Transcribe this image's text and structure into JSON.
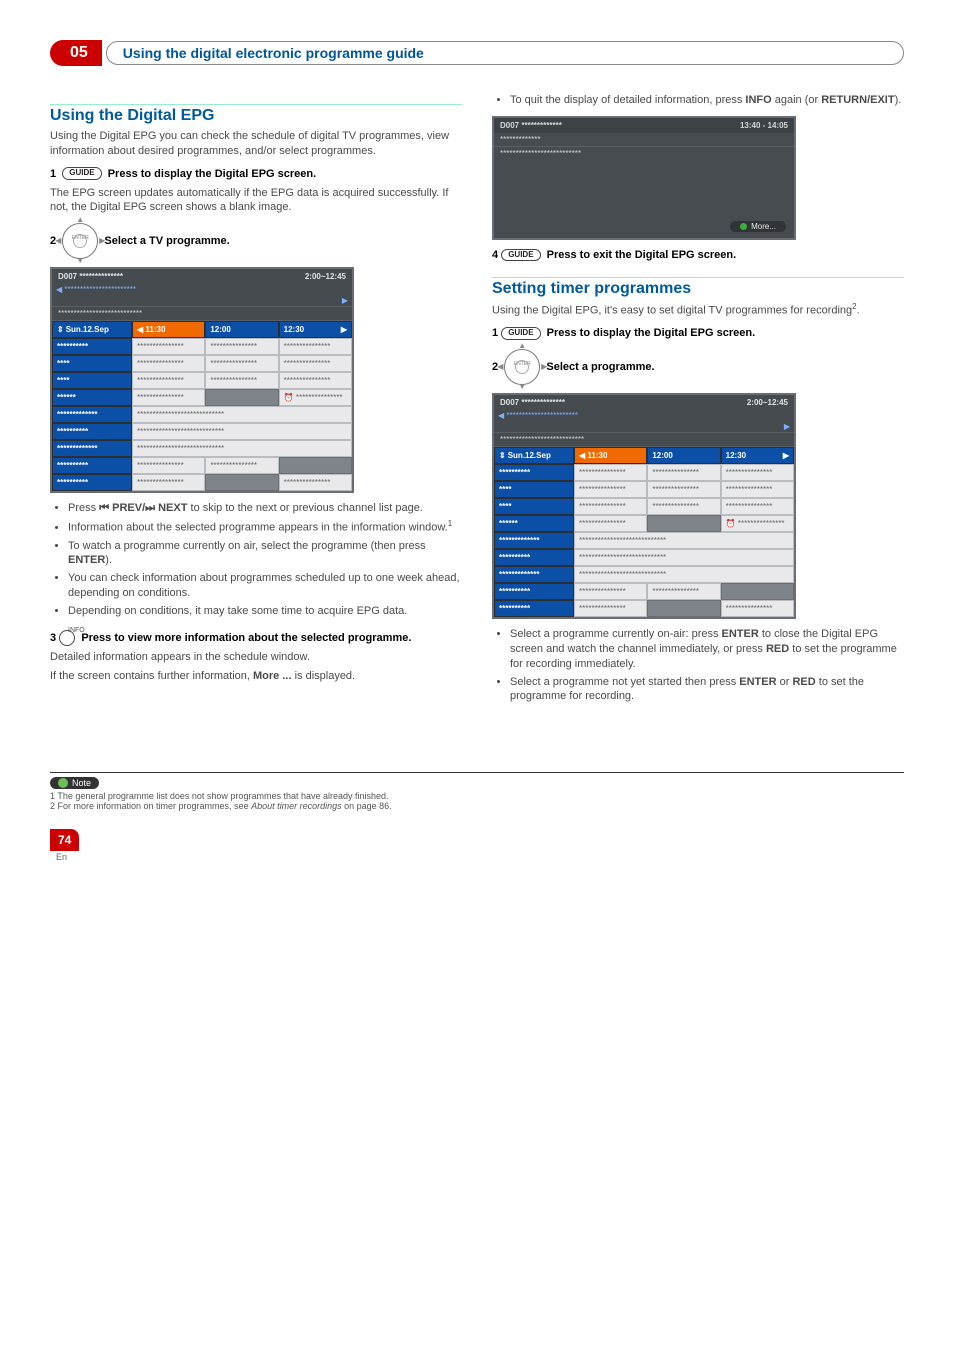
{
  "section": {
    "number": "05",
    "title": "Using the digital electronic programme guide"
  },
  "left": {
    "h_epg": "Using the Digital EPG",
    "intro": "Using the Digital EPG you can check the schedule of digital TV programmes, view information about desired programmes, and/or select programmes.",
    "step1_btn": "GUIDE",
    "step1_txt": "Press to display the Digital EPG screen.",
    "step1_desc": "The EPG screen updates automatically if the EPG data is acquired successfully. If not, the Digital EPG screen shows a blank image.",
    "step2_txt": "Select a TV programme.",
    "bullets1": [
      "Press ⏮ PREV/⏭ NEXT to skip to the next or previous channel list page.",
      "Information about the selected programme appears in the information window.",
      "To watch a programme currently on air, select the programme (then press ENTER).",
      "You can check information about programmes scheduled up to one week ahead, depending on conditions.",
      "Depending on conditions, it may take some time to acquire EPG data."
    ],
    "sup1": "1",
    "step3_label": "INFO",
    "step3_txt": "Press to view more information about the selected programme.",
    "step3_desc1": "Detailed information appears in the schedule window.",
    "step3_desc2": "If the screen contains further information, More ... is displayed."
  },
  "right": {
    "top_bullet": "To quit the display of detailed information, press INFO again (or RETURN/EXIT).",
    "info_top_left": "D007   *************",
    "info_top_right": "13:40 - 14:05",
    "info_line1": "*************",
    "info_line2": "**************************",
    "info_more": "More...",
    "step4_btn": "GUIDE",
    "step4_txt": "Press to exit the Digital EPG screen.",
    "h_timer": "Setting timer programmes",
    "timer_intro": "Using the Digital EPG, it's easy to set digital TV programmes for recording",
    "sup2": "2",
    "tstep1_btn": "GUIDE",
    "tstep1_txt": "Press to display the Digital EPG screen.",
    "tstep2_txt": "Select a programme.",
    "bullets2": [
      "Select a programme currently on-air: press ENTER to close the Digital EPG screen and watch the channel immediately, or press RED to set the programme for recording immediately.",
      "Select a programme not yet started then press ENTER or RED to set the programme for recording."
    ]
  },
  "epg": {
    "top_left": "D007   **************",
    "top_right": "2:00~12:45",
    "sub1": "***********************",
    "sub2": "***************************",
    "date": "Sun.12.Sep",
    "t1": "11:30",
    "t2": "12:00",
    "t3": "12:30",
    "rows": [
      "**********",
      "****",
      "****",
      "******",
      "*************",
      "**********",
      "*************",
      "**********",
      "**********"
    ],
    "cell": "***************",
    "long": "****************************",
    "clock": "⏰ ***************"
  },
  "notes": {
    "label": "Note",
    "n1": "1 The general programme list does not show programmes that have already finished.",
    "n2": "2 For more information on timer programmes, see About timer recordings on page 86."
  },
  "page": "74",
  "en": "En"
}
